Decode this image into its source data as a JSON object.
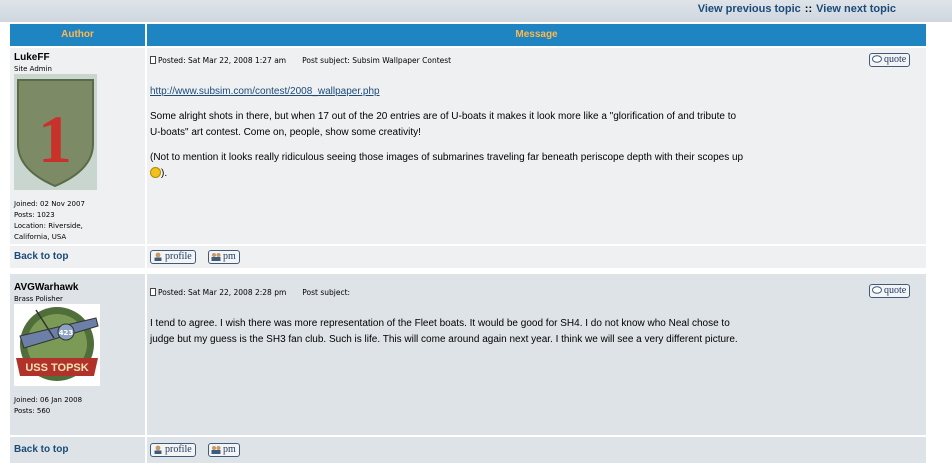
{
  "nav": {
    "prev_topic": "View previous topic",
    "separator": "::",
    "next_topic": "View next topic"
  },
  "table_headers": {
    "author": "Author",
    "message": "Message"
  },
  "posts": [
    {
      "author": "LukeFF",
      "rank": "Site Admin",
      "avatar_numeral": "1",
      "joined": "Joined: 02 Nov 2007",
      "posts": "Posts: 1023",
      "location_line1": "Location: Riverside,",
      "location_line2": "California, USA",
      "posted": "Posted: Sat Mar 22, 2008 1:27 am",
      "subject": "Post subject: Subsim Wallpaper Contest",
      "link": "http://www.subsim.com/contest/2008_wallpaper.php",
      "para1_line1": "Some alright shots in there, but when 17 out of the 20 entries are of U-boats it makes it look more like a \"glorification of and tribute to",
      "para1_line2": "U-boats\" art contest. Come on, people, show some creativity!",
      "para2_line1": "(Not to mention it looks really ridiculous seeing those images of submarines traveling far beneath periscope depth with their scopes up",
      "para2_end": ").",
      "back_to_top": "Back to top",
      "profile_label": "profile",
      "pm_label": "pm",
      "quote_label": "quote"
    },
    {
      "author": "AVGWarhawk",
      "rank": "Brass Polisher",
      "avatar_text": "USS TOPSK",
      "avatar_number": "423",
      "joined": "Joined: 06 Jan 2008",
      "posts": "Posts: 560",
      "posted": "Posted: Sat Mar 22, 2008 2:28 pm",
      "subject": "Post subject:",
      "para1_line1": "I tend to agree. I wish there was  more representation of the Fleet boats. It would be good for SH4. I do not know who  Neal chose to",
      "para1_line2": "judge but my guess is the SH3 fan club. Such is life. This will come around again next year. I think we will see a very different picture.",
      "back_to_top": "Back to top",
      "profile_label": "profile",
      "pm_label": "pm",
      "quote_label": "quote"
    }
  ],
  "colors": {
    "header_bg": "#1f84c2",
    "header_text": "#ffb84d",
    "link": "#1c4b78",
    "row1": "#eef0f2",
    "row2": "#dee3e7"
  }
}
